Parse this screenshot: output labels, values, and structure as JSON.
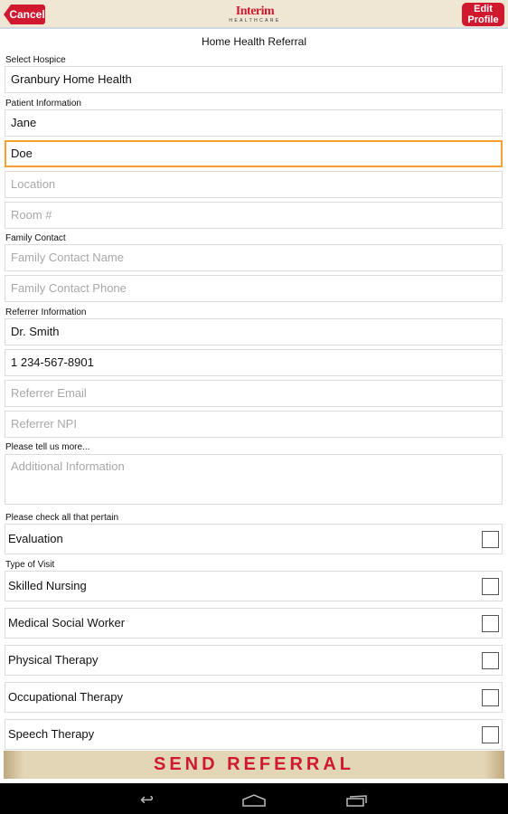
{
  "header": {
    "cancel": "Cancel",
    "edit_profile": "Edit Profile",
    "logo_main": "Interim",
    "logo_sub": "HEALTHCARE"
  },
  "title": "Home Health Referral",
  "labels": {
    "hospice": "Select Hospice",
    "patient": "Patient Information",
    "family": "Family Contact",
    "referrer": "Referrer Information",
    "more": "Please tell us more...",
    "check": "Please check all that pertain",
    "visit": "Type of Visit"
  },
  "fields": {
    "hospice": {
      "value": "Granbury Home Health"
    },
    "first_name": {
      "value": "Jane"
    },
    "last_name": {
      "value": "Doe"
    },
    "location": {
      "placeholder": "Location"
    },
    "room": {
      "placeholder": "Room #"
    },
    "family_name": {
      "placeholder": "Family Contact Name"
    },
    "family_phone": {
      "placeholder": "Family Contact Phone"
    },
    "referrer_name": {
      "value": "Dr. Smith"
    },
    "referrer_phone": {
      "value": "1 234-567-8901"
    },
    "referrer_email": {
      "placeholder": "Referrer Email"
    },
    "referrer_npi": {
      "placeholder": "Referrer NPI"
    },
    "additional": {
      "placeholder": "Additional Information"
    }
  },
  "checks": [
    {
      "label": "Evaluation",
      "checked": false
    },
    {
      "label": "Skilled Nursing",
      "checked": false
    },
    {
      "label": "Medical Social Worker",
      "checked": false
    },
    {
      "label": "Physical Therapy",
      "checked": false
    },
    {
      "label": "Occupational Therapy",
      "checked": false
    },
    {
      "label": "Speech Therapy",
      "checked": false
    }
  ],
  "send": "SEND REFERRAL",
  "nav": {
    "back": "back-icon",
    "home": "home-icon",
    "recents": "recents-icon"
  },
  "colors": {
    "accent": "#d0182f",
    "header_bg": "#efe7d4",
    "focus": "#f5a030"
  }
}
